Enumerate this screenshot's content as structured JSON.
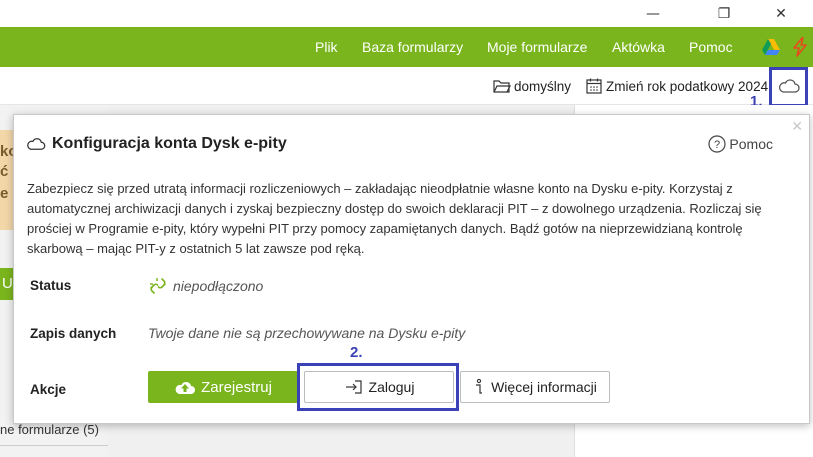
{
  "window": {
    "minimize": "—",
    "restore": "❐",
    "close": "✕"
  },
  "nav": {
    "items": [
      "Plik",
      "Baza formularzy",
      "Moje formularze",
      "Aktówka",
      "Pomoc"
    ]
  },
  "toolbar": {
    "folder_label": "domyślny",
    "year_label": "Zmień rok podatkowy 2024"
  },
  "background": {
    "frag_1": "ko",
    "frag_2": "ć",
    "frag_3": "e p",
    "frag_u": "U",
    "frag_forms": "ne formularze (5)"
  },
  "annotations": {
    "first": "1.",
    "second": "2."
  },
  "popup": {
    "title": "Konfiguracja konta Dysk e-pity",
    "help_label": "Pomoc",
    "close": "✕",
    "description": "Zabezpiecz się przed utratą informacji rozliczeniowych – zakładając nieodpłatnie własne konto na Dysku e-pity. Korzystaj z automatycznej archiwizacji danych i zyskaj bezpieczny dostęp do swoich deklaracji PIT – z dowolnego urządzenia. Rozliczaj się prościej w Programie e-pity, który wypełni PIT przy pomocy zapamiętanych danych. Bądź gotów na nieprzewidzianą kontrolę skarbową – mając PIT-y z ostatnich 5 lat zawsze pod ręką.",
    "status_label": "Status",
    "status_value": "niepodłączono",
    "storage_label": "Zapis danych",
    "storage_value": "Twoje dane nie są przechowywane na Dysku e-pity",
    "actions_label": "Akcje",
    "register_label": "Zarejestruj",
    "login_label": "Zaloguj",
    "info_label": "Więcej informacji"
  },
  "colors": {
    "brand_green": "#7ab51d",
    "annotation_blue": "#3b41b7"
  }
}
